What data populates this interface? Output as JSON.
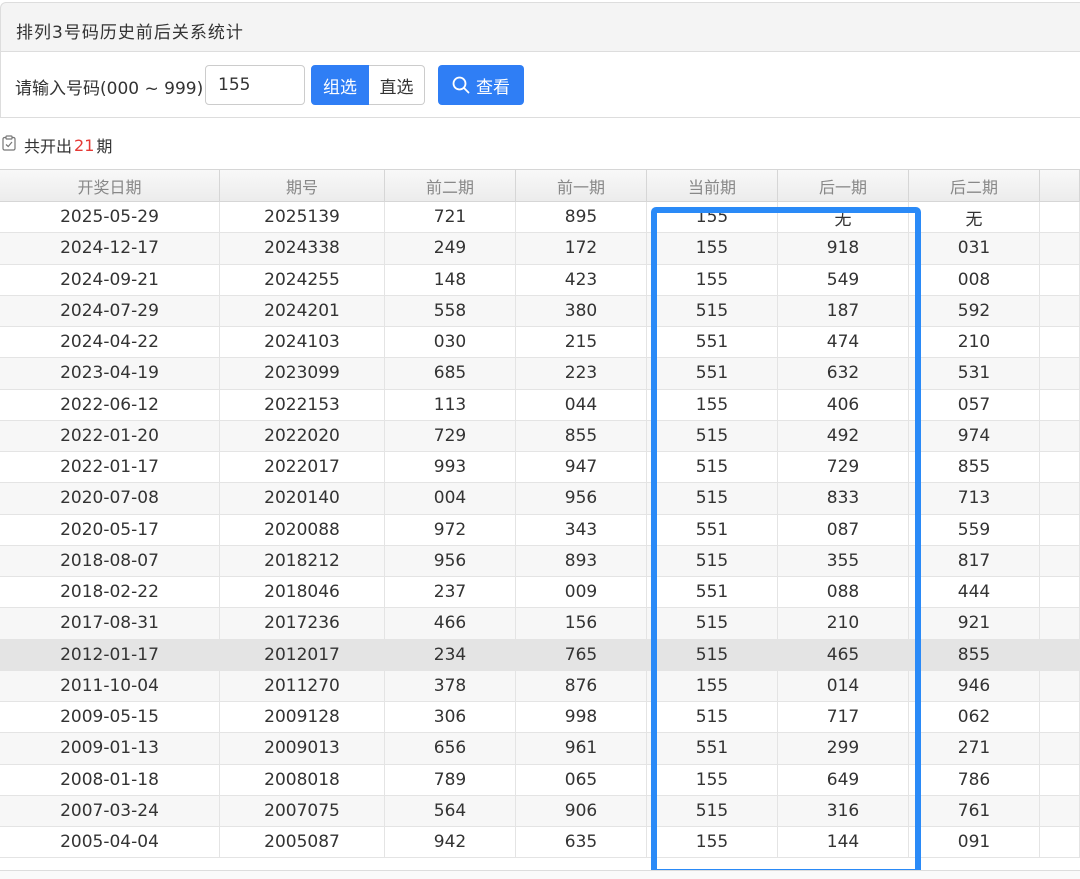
{
  "panel": {
    "title": "排列3号码历史前后关系统计",
    "input_label": "请输入号码(000 ~ 999)：",
    "input_value": "155",
    "mode_group": "组选",
    "mode_direct": "直选",
    "view_label": "查看"
  },
  "summary": {
    "prefix": "共开出",
    "count": "21",
    "suffix": "期"
  },
  "table": {
    "headers": [
      "开奖日期",
      "期号",
      "前二期",
      "前一期",
      "当前期",
      "后一期",
      "后二期"
    ],
    "rows": [
      [
        "2025-05-29",
        "2025139",
        "721",
        "895",
        "155",
        "无",
        "无"
      ],
      [
        "2024-12-17",
        "2024338",
        "249",
        "172",
        "155",
        "918",
        "031"
      ],
      [
        "2024-09-21",
        "2024255",
        "148",
        "423",
        "155",
        "549",
        "008"
      ],
      [
        "2024-07-29",
        "2024201",
        "558",
        "380",
        "515",
        "187",
        "592"
      ],
      [
        "2024-04-22",
        "2024103",
        "030",
        "215",
        "551",
        "474",
        "210"
      ],
      [
        "2023-04-19",
        "2023099",
        "685",
        "223",
        "551",
        "632",
        "531"
      ],
      [
        "2022-06-12",
        "2022153",
        "113",
        "044",
        "155",
        "406",
        "057"
      ],
      [
        "2022-01-20",
        "2022020",
        "729",
        "855",
        "515",
        "492",
        "974"
      ],
      [
        "2022-01-17",
        "2022017",
        "993",
        "947",
        "515",
        "729",
        "855"
      ],
      [
        "2020-07-08",
        "2020140",
        "004",
        "956",
        "515",
        "833",
        "713"
      ],
      [
        "2020-05-17",
        "2020088",
        "972",
        "343",
        "551",
        "087",
        "559"
      ],
      [
        "2018-08-07",
        "2018212",
        "956",
        "893",
        "515",
        "355",
        "817"
      ],
      [
        "2018-02-22",
        "2018046",
        "237",
        "009",
        "551",
        "088",
        "444"
      ],
      [
        "2017-08-31",
        "2017236",
        "466",
        "156",
        "515",
        "210",
        "921"
      ],
      [
        "2012-01-17",
        "2012017",
        "234",
        "765",
        "515",
        "465",
        "855"
      ],
      [
        "2011-10-04",
        "2011270",
        "378",
        "876",
        "155",
        "014",
        "946"
      ],
      [
        "2009-05-15",
        "2009128",
        "306",
        "998",
        "515",
        "717",
        "062"
      ],
      [
        "2009-01-13",
        "2009013",
        "656",
        "961",
        "551",
        "299",
        "271"
      ],
      [
        "2008-01-18",
        "2008018",
        "789",
        "065",
        "155",
        "649",
        "786"
      ],
      [
        "2007-03-24",
        "2007075",
        "564",
        "906",
        "515",
        "316",
        "761"
      ],
      [
        "2005-04-04",
        "2005087",
        "942",
        "635",
        "155",
        "144",
        "091"
      ]
    ],
    "highlighted_row": 14
  },
  "colors": {
    "accent": "#2f7ef5",
    "count_red": "#e53935",
    "annotation_box": "#2a8af7"
  },
  "icons": {
    "search": "search-icon",
    "summary": "clipboard-icon"
  }
}
